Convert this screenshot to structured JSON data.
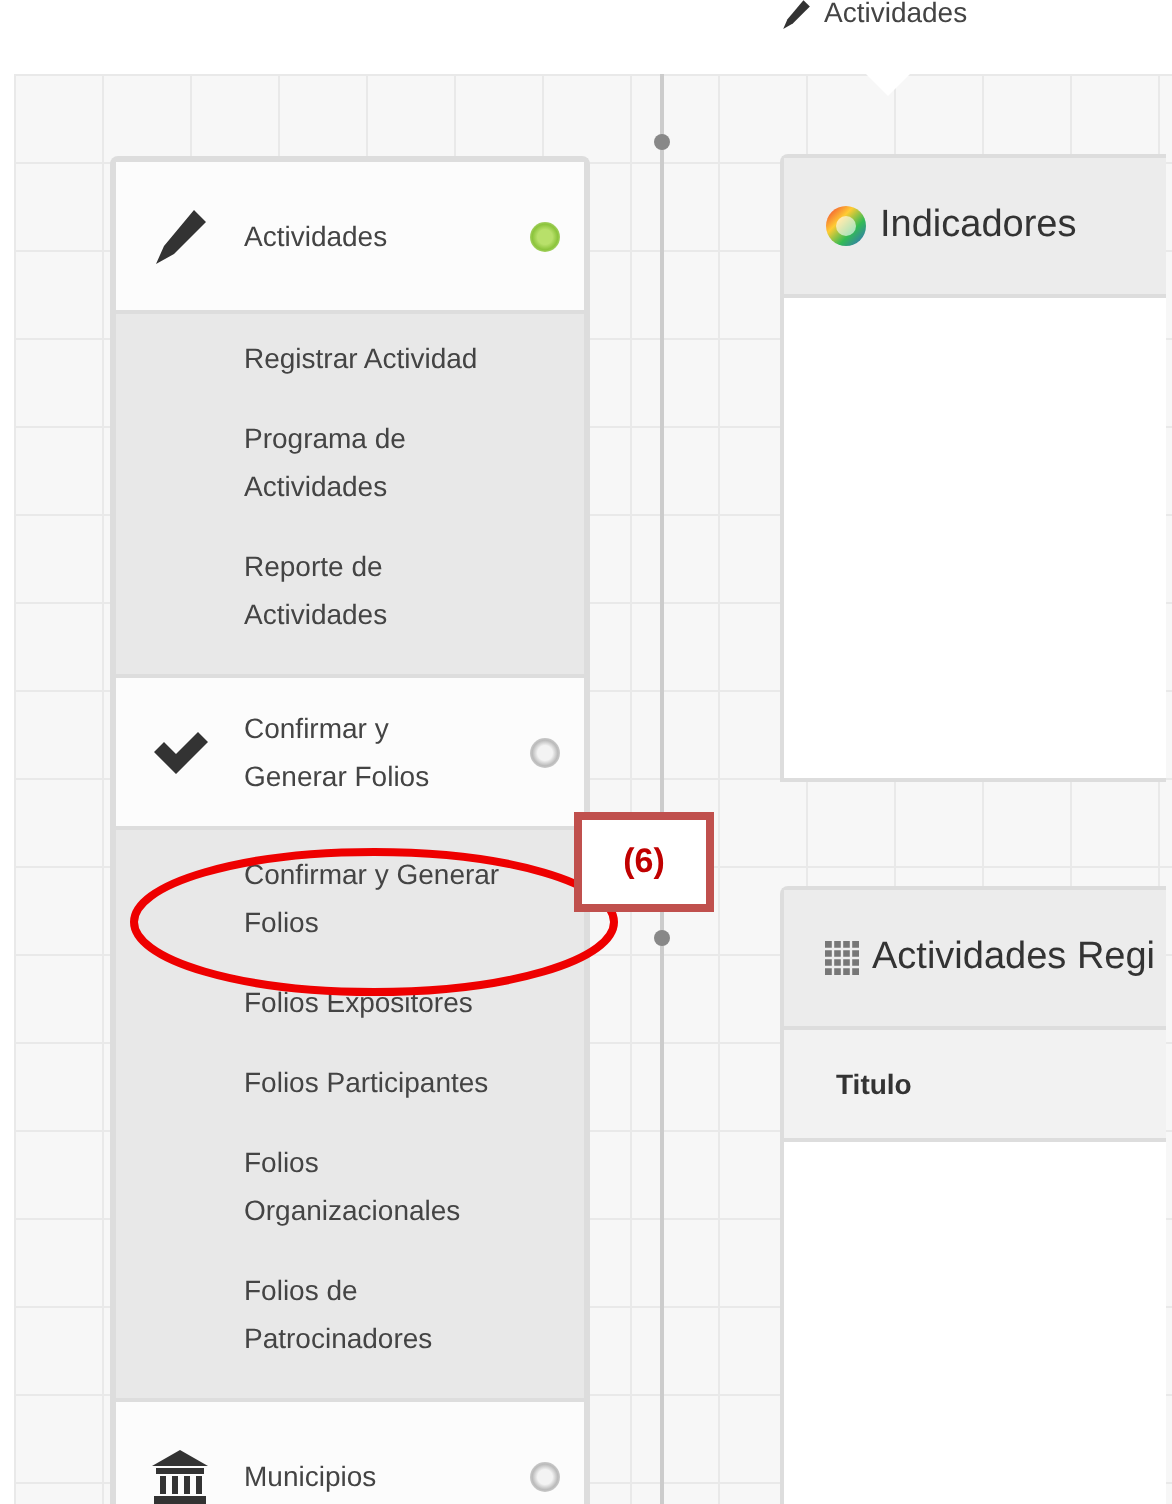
{
  "breadcrumb": {
    "label": "Actividades"
  },
  "menu": [
    {
      "label": "Actividades",
      "active": true,
      "items": [
        "Registrar Actividad",
        "Programa de Actividades",
        "Reporte de Actividades"
      ]
    },
    {
      "label": "Confirmar y Generar Folios",
      "active": false,
      "items": [
        "Confirmar y Generar Folios",
        "Folios Expositores",
        "Folios Participantes",
        "Folios Organizacionales",
        "Folios de Patrocinadores"
      ]
    },
    {
      "label": "Municipios",
      "active": false
    }
  ],
  "panels": [
    {
      "title": "Indicadores"
    },
    {
      "title": "Actividades Regi",
      "columns": [
        "Titulo"
      ]
    }
  ],
  "annotation": {
    "label": "(6)"
  }
}
